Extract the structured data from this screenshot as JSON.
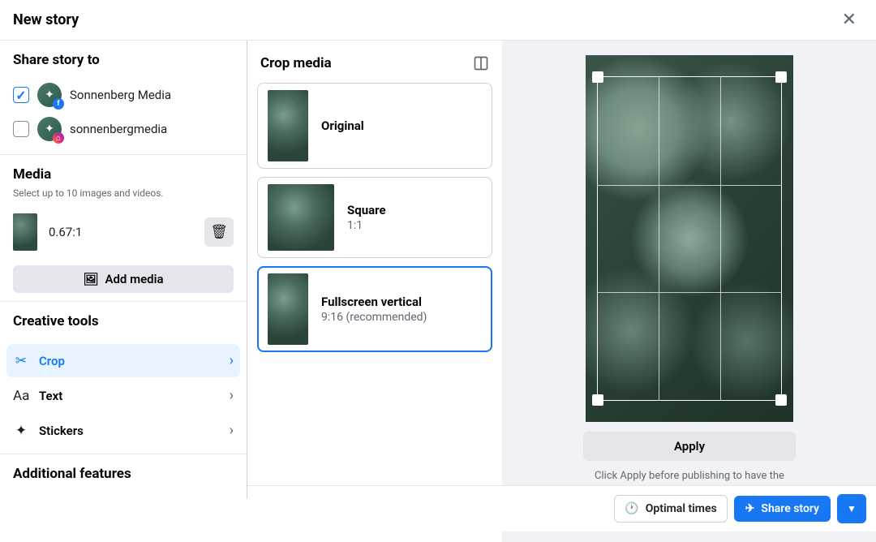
{
  "header": {
    "title": "New story"
  },
  "sidebar": {
    "share": {
      "title": "Share story to",
      "accounts": [
        {
          "checked": true,
          "platform": "facebook",
          "platform_glyph": "f",
          "name": "Sonnenberg Media"
        },
        {
          "checked": false,
          "platform": "instagram",
          "platform_glyph": "⌂",
          "name": "sonnenbergmedia"
        }
      ]
    },
    "media": {
      "title": "Media",
      "subtitle": "Select up to 10 images and videos.",
      "items": [
        {
          "ratio": "0.67:1"
        }
      ],
      "add_label": "Add media"
    },
    "tools": {
      "title": "Creative tools",
      "items": [
        {
          "icon": "✂",
          "label": "Crop",
          "active": true
        },
        {
          "icon": "Aa",
          "label": "Text",
          "active": false
        },
        {
          "icon": "✦",
          "label": "Stickers",
          "active": false
        }
      ]
    },
    "additional": {
      "title": "Additional features"
    }
  },
  "crop_panel": {
    "title": "Crop media",
    "options": [
      {
        "label": "Original",
        "sub": "",
        "shape": "tall",
        "selected": false
      },
      {
        "label": "Square",
        "sub": "1:1",
        "shape": "square",
        "selected": false
      },
      {
        "label": "Fullscreen vertical",
        "sub": "9:16 (recommended)",
        "shape": "tall",
        "selected": true
      }
    ]
  },
  "preview": {
    "apply_label": "Apply",
    "apply_msg": "Click Apply before publishing to have the changes you've made appear in your published story."
  },
  "footer": {
    "optimal_label": "Optimal times",
    "share_label": "Share story"
  }
}
